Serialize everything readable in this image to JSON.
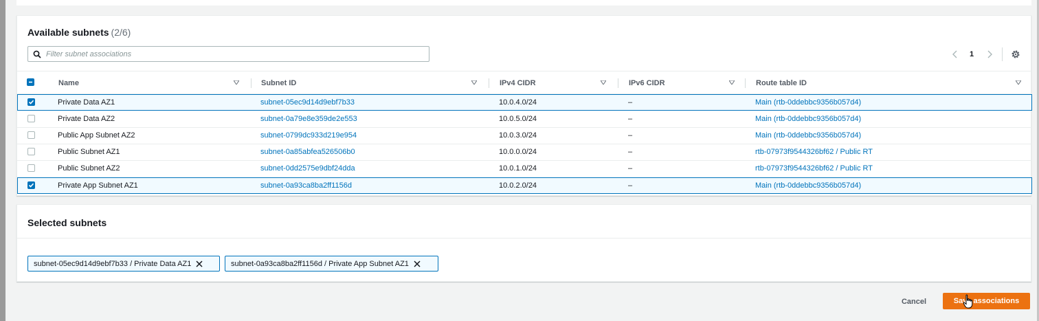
{
  "available": {
    "title": "Available subnets",
    "count": "(2/6)",
    "filter_placeholder": "Filter subnet associations",
    "page": "1",
    "columns": [
      "Name",
      "Subnet ID",
      "IPv4 CIDR",
      "IPv6 CIDR",
      "Route table ID"
    ],
    "rows": [
      {
        "checked": true,
        "name": "Private Data AZ1",
        "subnet_id": "subnet-05ec9d14d9ebf7b33",
        "ipv4": "10.0.4.0/24",
        "ipv6": "–",
        "route": "Main (rtb-0ddebbc9356b057d4)"
      },
      {
        "checked": false,
        "name": "Private Data AZ2",
        "subnet_id": "subnet-0a79e8e359de2e553",
        "ipv4": "10.0.5.0/24",
        "ipv6": "–",
        "route": "Main (rtb-0ddebbc9356b057d4)"
      },
      {
        "checked": false,
        "name": "Public App Subnet AZ2",
        "subnet_id": "subnet-0799dc933d219e954",
        "ipv4": "10.0.3.0/24",
        "ipv6": "–",
        "route": "Main (rtb-0ddebbc9356b057d4)"
      },
      {
        "checked": false,
        "name": "Public Subnet AZ1",
        "subnet_id": "subnet-0a85abfea526506b0",
        "ipv4": "10.0.0.0/24",
        "ipv6": "–",
        "route": "rtb-07973f9544326bf62 / Public RT"
      },
      {
        "checked": false,
        "name": "Public Subnet AZ2",
        "subnet_id": "subnet-0dd2575e9dbf24dda",
        "ipv4": "10.0.1.0/24",
        "ipv6": "–",
        "route": "rtb-07973f9544326bf62 / Public RT"
      },
      {
        "checked": true,
        "name": "Private App Subnet AZ1",
        "subnet_id": "subnet-0a93ca8ba2ff1156d",
        "ipv4": "10.0.2.0/24",
        "ipv6": "–",
        "route": "Main (rtb-0ddebbc9356b057d4)"
      }
    ]
  },
  "selected": {
    "title": "Selected subnets",
    "tokens": [
      "subnet-05ec9d14d9ebf7b33 / Private Data AZ1",
      "subnet-0a93ca8ba2ff1156d / Private App Subnet AZ1"
    ]
  },
  "actions": {
    "cancel_label": "Cancel",
    "save_label": "Save associations"
  },
  "icons": {
    "search": "search-icon",
    "prev": "chevron-left-icon",
    "next": "chevron-right-icon",
    "settings": "gear-icon",
    "sort": "sort-down-icon",
    "remove": "close-icon",
    "cursor": "hand-pointer-icon"
  },
  "colors": {
    "accent": "#0073bb",
    "primary_button": "#ec7211",
    "selected_row_bg": "#f1faff"
  }
}
